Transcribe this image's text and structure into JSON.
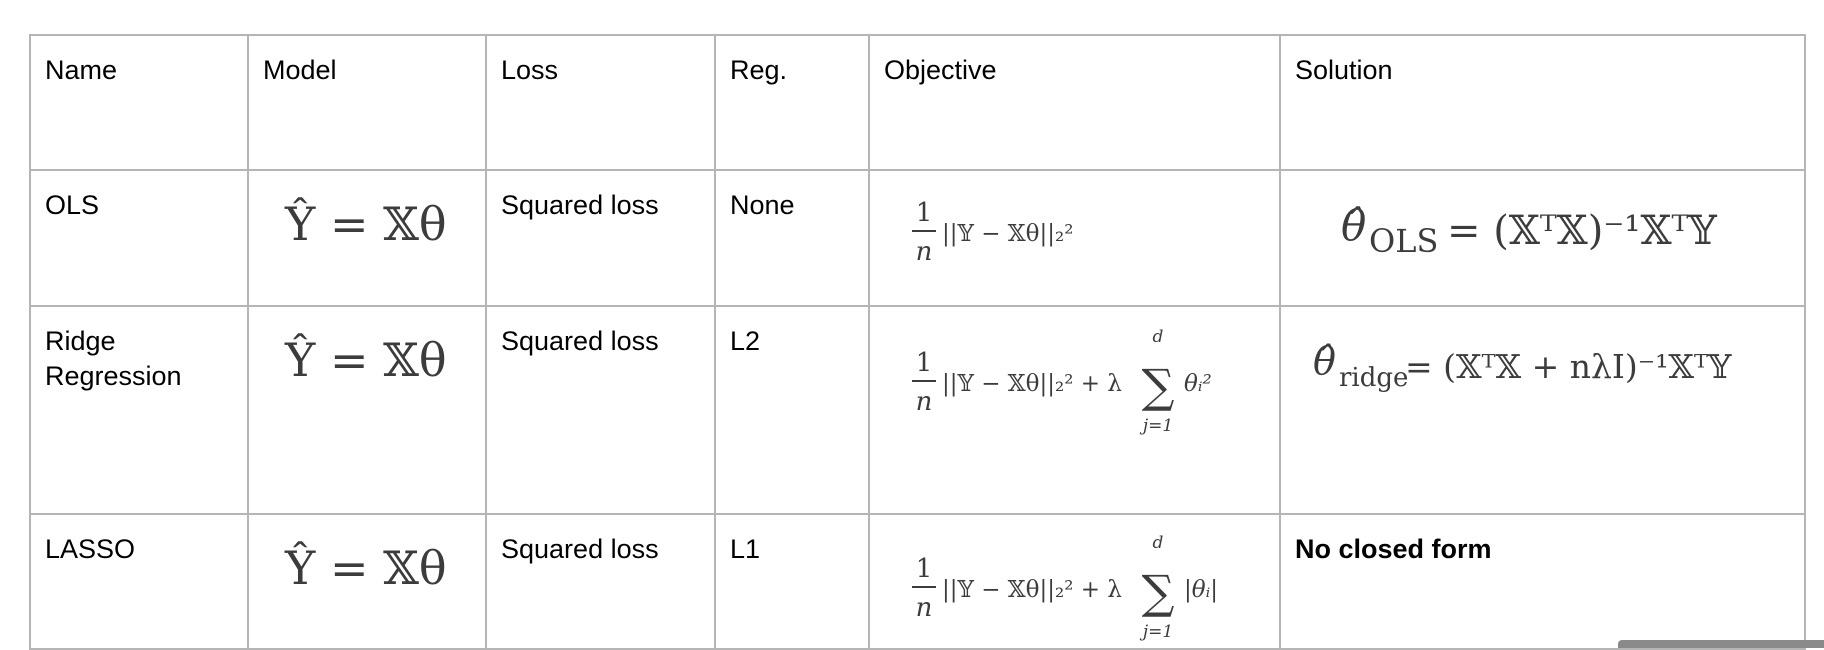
{
  "headers": {
    "name": "Name",
    "model": "Model",
    "loss": "Loss",
    "reg": "Reg.",
    "objective": "Objective",
    "solution": "Solution"
  },
  "rows": [
    {
      "name": "OLS",
      "model": "Ŷ = 𝕏θ",
      "loss": "Squared loss",
      "reg": "None",
      "objective": {
        "frac_num": "1",
        "frac_den": "n",
        "body": "||𝕐 − 𝕏θ||₂²"
      },
      "solution": {
        "lhs": "θ̂",
        "sub": "OLS",
        "rhs": "= (𝕏ᵀ𝕏)⁻¹𝕏ᵀ𝕐"
      }
    },
    {
      "name": "Ridge Regression",
      "model": "Ŷ = 𝕏θ",
      "loss": "Squared loss",
      "reg": "L2",
      "objective": {
        "frac_num": "1",
        "frac_den": "n",
        "body": "||𝕐 − 𝕏θ||₂² + λ",
        "sum_top": "d",
        "sum_bottom": "j=1",
        "term": "θᵢ²"
      },
      "solution": {
        "lhs": "θ̂",
        "sub": "ridge",
        "rhs": "= (𝕏ᵀ𝕏 + nλI)⁻¹𝕏ᵀ𝕐"
      }
    },
    {
      "name": "LASSO",
      "model": "Ŷ = 𝕏θ",
      "loss": "Squared loss",
      "reg": "L1",
      "objective": {
        "frac_num": "1",
        "frac_den": "n",
        "body": "||𝕐 − 𝕏θ||₂² + λ",
        "sum_top": "d",
        "sum_bottom": "j=1",
        "term": "|θᵢ|"
      },
      "solution": {
        "text": "No closed form"
      }
    }
  ]
}
